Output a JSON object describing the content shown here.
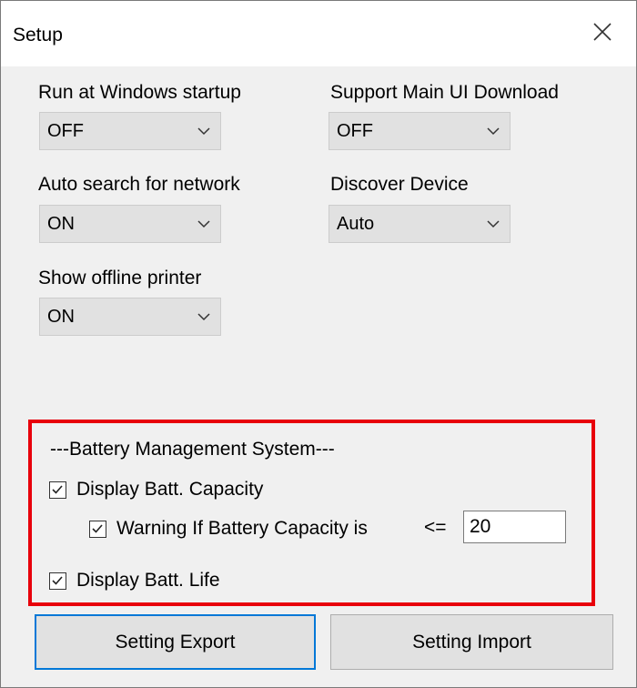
{
  "window": {
    "title": "Setup"
  },
  "settings": {
    "run_at_startup": {
      "label": "Run at Windows startup",
      "value": "OFF"
    },
    "support_main_ui_download": {
      "label": "Support Main UI Download",
      "value": "OFF"
    },
    "auto_search_network": {
      "label": "Auto search for network",
      "value": "ON"
    },
    "discover_device": {
      "label": "Discover Device",
      "value": "Auto"
    },
    "show_offline_printer": {
      "label": "Show offline printer",
      "value": "ON"
    }
  },
  "battery": {
    "heading": "---Battery Management System---",
    "display_capacity": {
      "label": "Display Batt. Capacity",
      "checked": true
    },
    "warning": {
      "label": "Warning If Battery Capacity is",
      "operator": "<=",
      "threshold": "20",
      "checked": true
    },
    "display_life": {
      "label": "Display Batt. Life",
      "checked": true
    }
  },
  "buttons": {
    "export": "Setting Export",
    "import": "Setting Import"
  },
  "colors": {
    "highlight_border": "#e8000b",
    "focus_border": "#0078d7",
    "window_bg": "#f0f0f0",
    "control_bg": "#e1e1e1"
  },
  "icons": {
    "close": "close-icon",
    "chevron": "chevron-down-icon",
    "check": "checkmark-icon"
  }
}
